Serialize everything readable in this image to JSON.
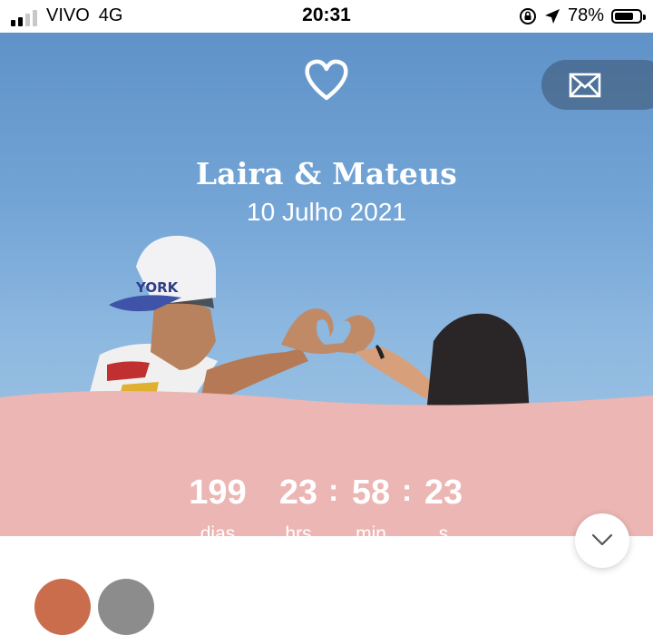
{
  "status_bar": {
    "carrier": "VIVO",
    "network": "4G",
    "time": "20:31",
    "battery": "78%",
    "battery_level": 0.78,
    "icons": [
      "signal-icon",
      "orientation-lock-icon",
      "location-arrow-icon",
      "battery-icon"
    ]
  },
  "hero": {
    "logo_icon": "heart-icon",
    "mail_icon": "envelope-icon",
    "couple_names": "Laira & Mateus",
    "date": "10 Julho 2021"
  },
  "countdown": {
    "days": "199",
    "days_label": "dias",
    "hours": "23",
    "hours_label": "hrs",
    "minutes": "58",
    "minutes_label": "min",
    "seconds": "23",
    "seconds_label": "s",
    "separator": ":"
  },
  "scroll_icon": "chevron-down-icon",
  "colors": {
    "sky": "#74a5d6",
    "countdown_band": "#ebb6b3",
    "mail_button": "#3a526e"
  }
}
